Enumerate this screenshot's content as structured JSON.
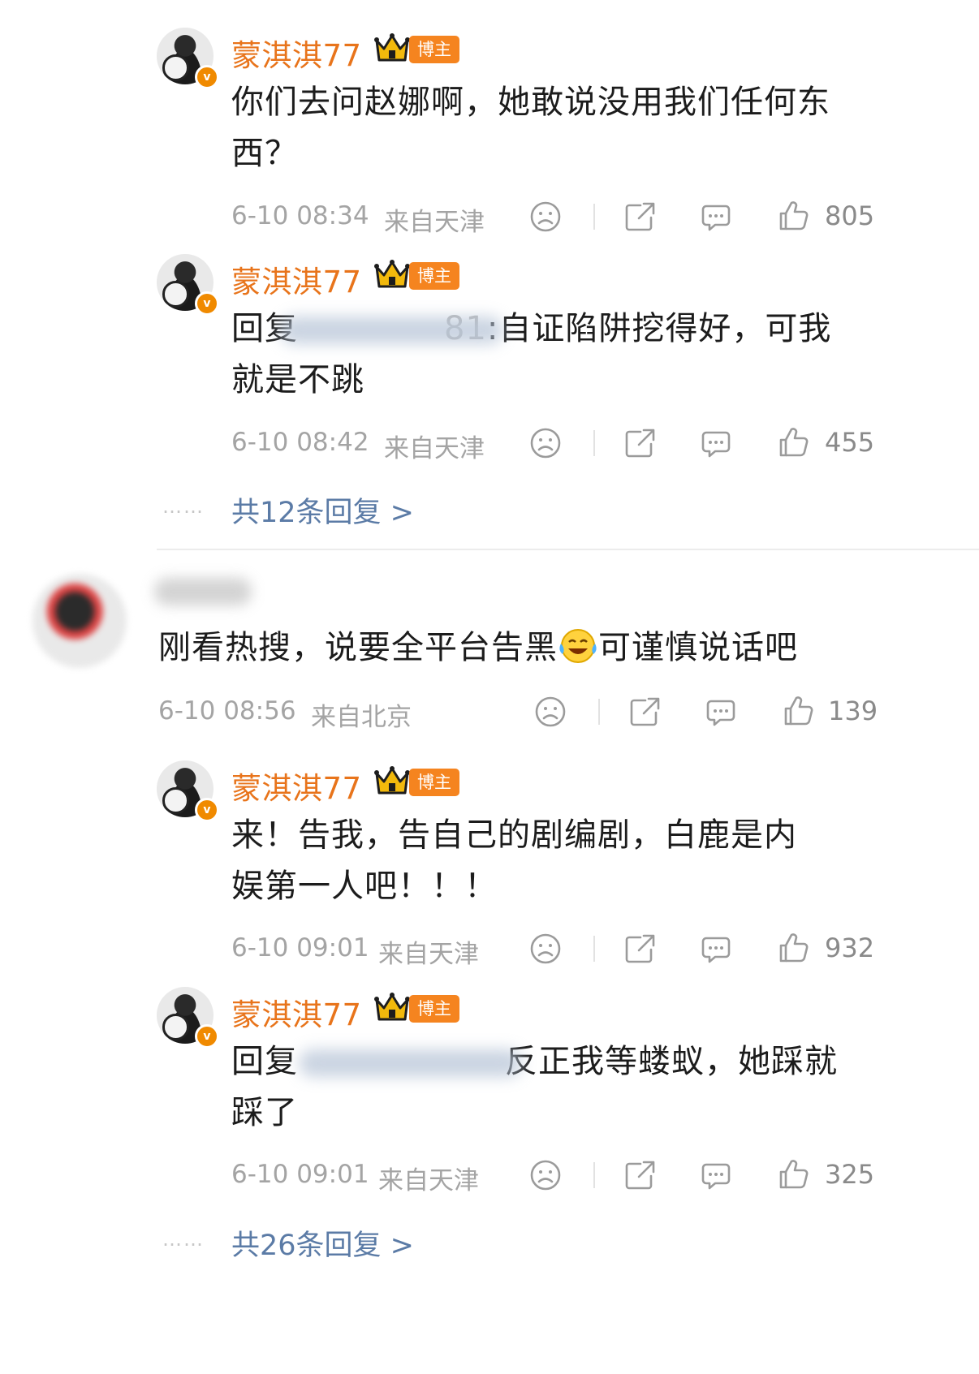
{
  "colors": {
    "name": "#e8741b",
    "link": "#5b7ba6",
    "meta": "#a4a4a4",
    "tag_bg": "#f5841f"
  },
  "icons": [
    "verified-badge-icon",
    "crown-icon",
    "sad-face-icon",
    "share-icon",
    "comment-icon",
    "like-icon",
    "laughing-crying-emoji-icon"
  ],
  "replies_a": [
    {
      "name": "蒙淇淇77",
      "tag": "博主",
      "line1": "你们去问赵娜啊，她敢说没用我们任何东",
      "line2": "西？",
      "time": "6-10 08:34",
      "location": "来自天津",
      "likes": "805"
    },
    {
      "name": "蒙淇淇77",
      "tag": "博主",
      "prefix": "回复",
      "partial": "81",
      "line1_rest": ":自证陷阱挖得好，可我",
      "line2": "就是不跳",
      "time": "6-10 08:42",
      "location": "来自天津",
      "likes": "455"
    }
  ],
  "more_a": {
    "dots": "……",
    "label": "共12条回复 >"
  },
  "comment": {
    "text_before": "刚看热搜，说要全平台告黑",
    "text_after": "可谨慎说话吧",
    "time": "6-10 08:56",
    "location": "来自北京",
    "likes": "139"
  },
  "replies_b": [
    {
      "name": "蒙淇淇77",
      "tag": "博主",
      "line1": "来！告我，告自己的剧编剧，白鹿是内",
      "line2": "娱第一人吧！！！",
      "time": "6-10 09:01",
      "location": "来自天津",
      "likes": "932"
    },
    {
      "name": "蒙淇淇77",
      "tag": "博主",
      "prefix": "回复",
      "line1_rest": "反正我等蝼蚁，她踩就",
      "line2": "踩了",
      "time": "6-10 09:01",
      "location": "来自天津",
      "likes": "325"
    }
  ],
  "more_b": {
    "dots": "……",
    "label": "共26条回复 >"
  }
}
